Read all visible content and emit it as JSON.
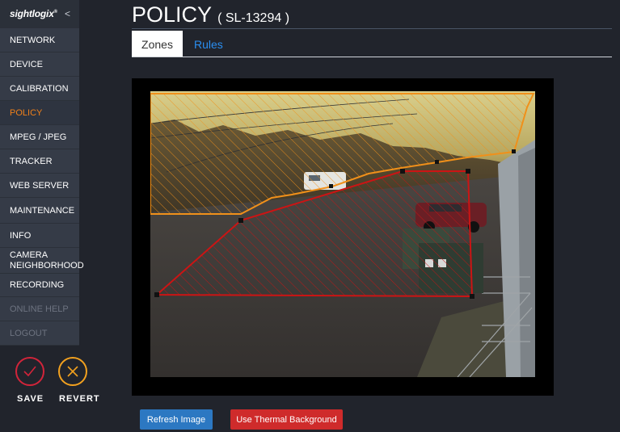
{
  "sidebar": {
    "logo": "sightlogix",
    "logo_mark": "®",
    "collapse_symbol": "<",
    "items": [
      {
        "label": "NETWORK"
      },
      {
        "label": "DEVICE"
      },
      {
        "label": "CALIBRATION"
      },
      {
        "label": "POLICY"
      },
      {
        "label": "MPEG / JPEG"
      },
      {
        "label": "TRACKER"
      },
      {
        "label": "WEB SERVER"
      },
      {
        "label": "MAINTENANCE"
      },
      {
        "label": "INFO"
      },
      {
        "label": "CAMERA NEIGHBORHOOD"
      },
      {
        "label": "RECORDING"
      },
      {
        "label": "ONLINE HELP"
      },
      {
        "label": "LOGOUT"
      }
    ],
    "active_item": "POLICY",
    "save_label": "SAVE",
    "revert_label": "REVERT"
  },
  "header": {
    "title": "POLICY",
    "subtitle": "( SL-13294 )"
  },
  "tabs": [
    {
      "label": "Zones"
    },
    {
      "label": "Rules"
    }
  ],
  "active_tab": "Zones",
  "buttons": {
    "refresh": "Refresh Image",
    "thermal": "Use Thermal Background"
  },
  "colors": {
    "accent": "#f0801a",
    "zone_orange": "#f0901a",
    "zone_red": "#cc1414",
    "save": "#d2243a",
    "revert": "#f2a11f",
    "link": "#2a8ef0"
  }
}
